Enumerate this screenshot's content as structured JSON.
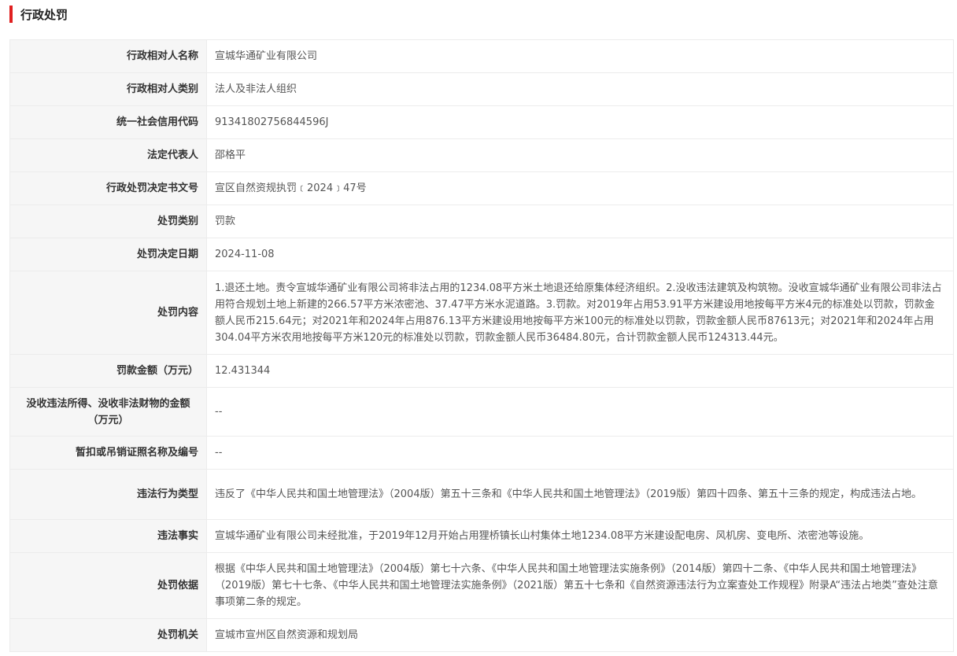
{
  "section": {
    "title": "行政处罚"
  },
  "accent_color": "#e02020",
  "rows": [
    {
      "label": "行政相对人名称",
      "value": "宣城华通矿业有限公司"
    },
    {
      "label": "行政相对人类别",
      "value": "法人及非法人组织"
    },
    {
      "label": "统一社会信用代码",
      "value": "91341802756844596J"
    },
    {
      "label": "法定代表人",
      "value": "邵格平"
    },
    {
      "label": "行政处罚决定书文号",
      "value": "宣区自然资规执罚﹝2024﹞47号"
    },
    {
      "label": "处罚类别",
      "value": "罚款"
    },
    {
      "label": "处罚决定日期",
      "value": "2024-11-08"
    },
    {
      "label": "处罚内容",
      "value": "1.退还土地。责令宣城华通矿业有限公司将非法占用的1234.08平方米土地退还给原集体经济组织。2.没收违法建筑及构筑物。没收宣城华通矿业有限公司非法占用符合规划土地上新建的266.57平方米浓密池、37.47平方米水泥道路。3.罚款。对2019年占用53.91平方米建设用地按每平方米4元的标准处以罚款，罚款金额人民币215.64元；对2021年和2024年占用876.13平方米建设用地按每平方米100元的标准处以罚款，罚款金额人民币87613元；对2021年和2024年占用304.04平方米农用地按每平方米120元的标准处以罚款，罚款金额人民币36484.80元，合计罚款金额人民币124313.44元。"
    },
    {
      "label": "罚款金额（万元）",
      "value": "12.431344"
    },
    {
      "label": "没收违法所得、没收非法财物的金额（万元）",
      "value": "--"
    },
    {
      "label": "暂扣或吊销证照名称及编号",
      "value": "--"
    },
    {
      "label": "违法行为类型",
      "value": "违反了《中华人民共和国土地管理法》（2004版）第五十三条和《中华人民共和国土地管理法》（2019版）第四十四条、第五十三条的规定，构成违法占地。"
    },
    {
      "label": "违法事实",
      "value": "宣城华通矿业有限公司未经批准，于2019年12月开始占用狸桥镇长山村集体土地1234.08平方米建设配电房、风机房、变电所、浓密池等设施。"
    },
    {
      "label": "处罚依据",
      "value": "根据《中华人民共和国土地管理法》（2004版）第七十六条、《中华人民共和国土地管理法实施条例》（2014版）第四十二条、《中华人民共和国土地管理法》（2019版）第七十七条、《中华人民共和国土地管理法实施条例》（2021版）第五十七条和《自然资源违法行为立案查处工作规程》附录A“违法占地类”查处注意事项第二条的规定。"
    },
    {
      "label": "处罚机关",
      "value": "宣城市宣州区自然资源和规划局"
    }
  ]
}
